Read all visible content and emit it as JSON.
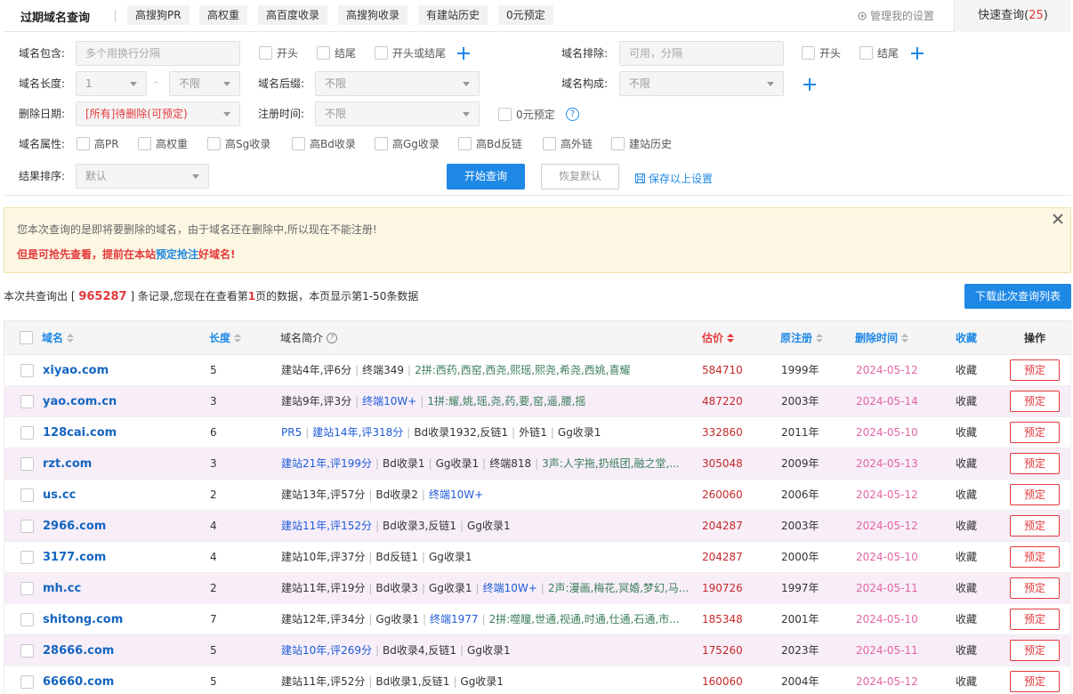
{
  "header": {
    "title": "过期域名查询",
    "tabs": [
      "高搜狗PR",
      "高权重",
      "高百度收录",
      "高搜狗收录",
      "有建站历史",
      "0元预定"
    ],
    "manage_label": "管理我的设置",
    "quick_label": "快速查询(",
    "quick_count": "25",
    "quick_close": ")"
  },
  "filters": {
    "include_label": "域名包含:",
    "include_placeholder": "多个用换行分隔",
    "include_opts": [
      "开头",
      "结尾",
      "开头或结尾"
    ],
    "exclude_label": "域名排除:",
    "exclude_placeholder": "可用，分隔",
    "exclude_opts": [
      "开头",
      "结尾"
    ],
    "length_label": "域名长度:",
    "length_min": "1",
    "length_dash": "-",
    "length_max": "不限",
    "suffix_label": "域名后缀:",
    "suffix_value": "不限",
    "compose_label": "域名构成:",
    "compose_value": "不限",
    "delete_label": "删除日期:",
    "delete_value": "[所有]待删除(可预定)",
    "regtime_label": "注册时间:",
    "regtime_value": "不限",
    "zero_label": "0元预定",
    "help": "?",
    "attr_label": "域名属性:",
    "attrs": [
      "高PR",
      "高权重",
      "高Sg收录",
      "高Bd收录",
      "高Gg收录",
      "高Bd反链",
      "高外链",
      "建站历史"
    ],
    "sort_label": "结果排序:",
    "sort_value": "默认",
    "search_button": "开始查询",
    "reset_button": "恢复默认",
    "save_link": "保存以上设置"
  },
  "notice": {
    "line1": "您本次查询的是即将要删除的域名，由于域名还在删除中,所以现在不能注册!",
    "line2_a": "但是可抢先查看，提前在本站",
    "line2_link": "预定抢注",
    "line2_b": "好域名!"
  },
  "summary": {
    "pre": "本次共查询出 [ ",
    "total": "965287",
    "mid": " ] 条记录,您现在在查看第",
    "page": "1",
    "post": "页的数据，本页显示第1-50条数据",
    "download_button": "下载此次查询列表"
  },
  "table": {
    "columns": [
      "域名",
      "长度",
      "域名简介",
      "估价",
      "原注册",
      "删除时间",
      "收藏",
      "操作"
    ],
    "intro_help": "?",
    "rows": [
      {
        "domain": "xiyao.com",
        "len": "5",
        "intro": [
          {
            "t": "建站4年,评6分",
            "c": ""
          },
          {
            "t": "终端349",
            "c": ""
          },
          {
            "t": "2拼:西药,西窑,西尧,熙瑶,熙尧,希尧,西姚,喜耀",
            "c": "green"
          }
        ],
        "price": "584710",
        "reg": "1999年",
        "del": "2024-05-12",
        "fav": "收藏",
        "op": "预定"
      },
      {
        "domain": "yao.com.cn",
        "len": "3",
        "intro": [
          {
            "t": "建站9年,评3分",
            "c": ""
          },
          {
            "t": "终端10W+",
            "c": "blue"
          },
          {
            "t": "1拼:耀,姚,瑶,尧,药,要,窑,遥,腰,摇",
            "c": "green"
          }
        ],
        "price": "487220",
        "reg": "2003年",
        "del": "2024-05-14",
        "fav": "收藏",
        "op": "预定"
      },
      {
        "domain": "128cai.com",
        "len": "6",
        "intro": [
          {
            "t": "PR5",
            "c": "blue"
          },
          {
            "t": "建站14年,评318分",
            "c": "blue"
          },
          {
            "t": "Bd收录1932,反链1",
            "c": ""
          },
          {
            "t": "外链1",
            "c": ""
          },
          {
            "t": "Gg收录1",
            "c": ""
          }
        ],
        "price": "332860",
        "reg": "2011年",
        "del": "2024-05-10",
        "fav": "收藏",
        "op": "预定"
      },
      {
        "domain": "rzt.com",
        "len": "3",
        "intro": [
          {
            "t": "建站21年,评199分",
            "c": "blue"
          },
          {
            "t": "Bd收录1",
            "c": ""
          },
          {
            "t": "Gg收录1",
            "c": ""
          },
          {
            "t": "终端818",
            "c": ""
          },
          {
            "t": "3声:人字拖,扔纸团,融之堂,...",
            "c": "green"
          }
        ],
        "price": "305048",
        "reg": "2009年",
        "del": "2024-05-13",
        "fav": "收藏",
        "op": "预定"
      },
      {
        "domain": "us.cc",
        "len": "2",
        "intro": [
          {
            "t": "建站13年,评57分",
            "c": ""
          },
          {
            "t": "Bd收录2",
            "c": ""
          },
          {
            "t": "终端10W+",
            "c": "blue"
          }
        ],
        "price": "260060",
        "reg": "2006年",
        "del": "2024-05-12",
        "fav": "收藏",
        "op": "预定"
      },
      {
        "domain": "2966.com",
        "len": "4",
        "intro": [
          {
            "t": "建站11年,评152分",
            "c": "blue"
          },
          {
            "t": "Bd收录3,反链1",
            "c": ""
          },
          {
            "t": "Gg收录1",
            "c": ""
          }
        ],
        "price": "204287",
        "reg": "2003年",
        "del": "2024-05-12",
        "fav": "收藏",
        "op": "预定"
      },
      {
        "domain": "3177.com",
        "len": "4",
        "intro": [
          {
            "t": "建站10年,评37分",
            "c": ""
          },
          {
            "t": "Bd反链1",
            "c": ""
          },
          {
            "t": "Gg收录1",
            "c": ""
          }
        ],
        "price": "204287",
        "reg": "2000年",
        "del": "2024-05-10",
        "fav": "收藏",
        "op": "预定"
      },
      {
        "domain": "mh.cc",
        "len": "2",
        "intro": [
          {
            "t": "建站11年,评19分",
            "c": ""
          },
          {
            "t": "Bd收录3",
            "c": ""
          },
          {
            "t": "Gg收录1",
            "c": ""
          },
          {
            "t": "终端10W+",
            "c": "blue"
          },
          {
            "t": "2声:漫画,梅花,冥婚,梦幻,马...",
            "c": "green"
          }
        ],
        "price": "190726",
        "reg": "1997年",
        "del": "2024-05-11",
        "fav": "收藏",
        "op": "预定"
      },
      {
        "domain": "shitong.com",
        "len": "7",
        "intro": [
          {
            "t": "建站12年,评34分",
            "c": ""
          },
          {
            "t": "Gg收录1",
            "c": ""
          },
          {
            "t": "终端1977",
            "c": "blue"
          },
          {
            "t": "2拼:噬瞳,世通,视通,时通,仕通,石通,市...",
            "c": "green"
          }
        ],
        "price": "185348",
        "reg": "2001年",
        "del": "2024-05-10",
        "fav": "收藏",
        "op": "预定"
      },
      {
        "domain": "28666.com",
        "len": "5",
        "intro": [
          {
            "t": "建站10年,评269分",
            "c": "blue"
          },
          {
            "t": "Bd收录4,反链1",
            "c": ""
          },
          {
            "t": "Gg收录1",
            "c": ""
          }
        ],
        "price": "175260",
        "reg": "2023年",
        "del": "2024-05-11",
        "fav": "收藏",
        "op": "预定"
      },
      {
        "domain": "66660.com",
        "len": "5",
        "intro": [
          {
            "t": "建站11年,评52分",
            "c": ""
          },
          {
            "t": "Bd收录1,反链1",
            "c": ""
          },
          {
            "t": "Gg收录1",
            "c": ""
          }
        ],
        "price": "160060",
        "reg": "2004年",
        "del": "2024-05-12",
        "fav": "收藏",
        "op": "预定"
      }
    ]
  },
  "colors": {
    "primary": "#1e88e5",
    "danger": "#e4393c",
    "row_alt": "#f7eef8"
  }
}
